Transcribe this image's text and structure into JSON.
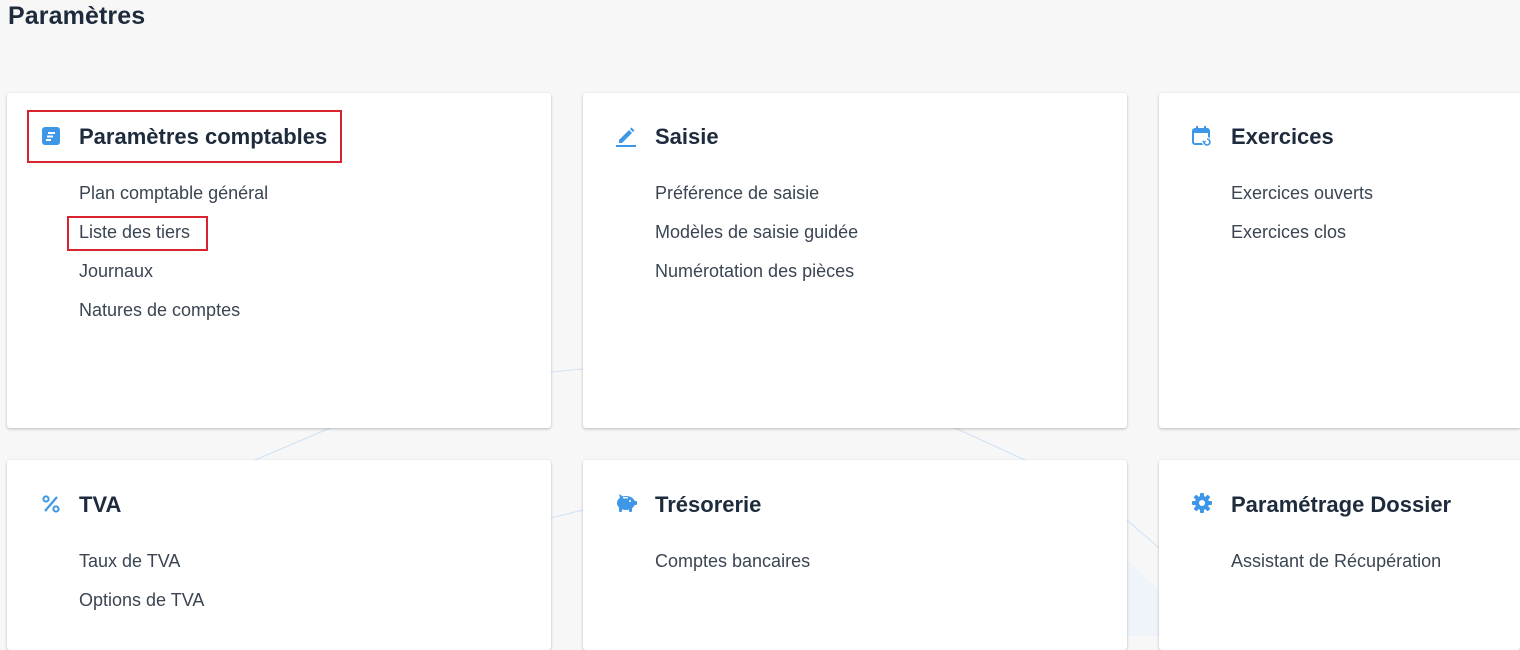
{
  "page": {
    "title": "Paramètres"
  },
  "colors": {
    "accent": "#3d97e6",
    "highlight": "#d9232e",
    "title_text": "#1e2b3c",
    "link_text": "#3a4552"
  },
  "cards": [
    {
      "icon": "document-list-icon",
      "title": "Paramètres comptables",
      "links": [
        "Plan comptable général",
        "Liste des tiers",
        "Journaux",
        "Natures de comptes"
      ]
    },
    {
      "icon": "pencil-icon",
      "title": "Saisie",
      "links": [
        "Préférence de saisie",
        "Modèles de saisie guidée",
        "Numérotation des pièces"
      ]
    },
    {
      "icon": "calendar-refresh-icon",
      "title": "Exercices",
      "links": [
        "Exercices ouverts",
        "Exercices clos"
      ]
    },
    {
      "icon": "percent-icon",
      "title": "TVA",
      "links": [
        "Taux de TVA",
        "Options de TVA"
      ]
    },
    {
      "icon": "piggy-bank-icon",
      "title": "Trésorerie",
      "links": [
        "Comptes bancaires"
      ]
    },
    {
      "icon": "gear-icon",
      "title": "Paramétrage Dossier",
      "links": [
        "Assistant de Récupération"
      ]
    }
  ]
}
